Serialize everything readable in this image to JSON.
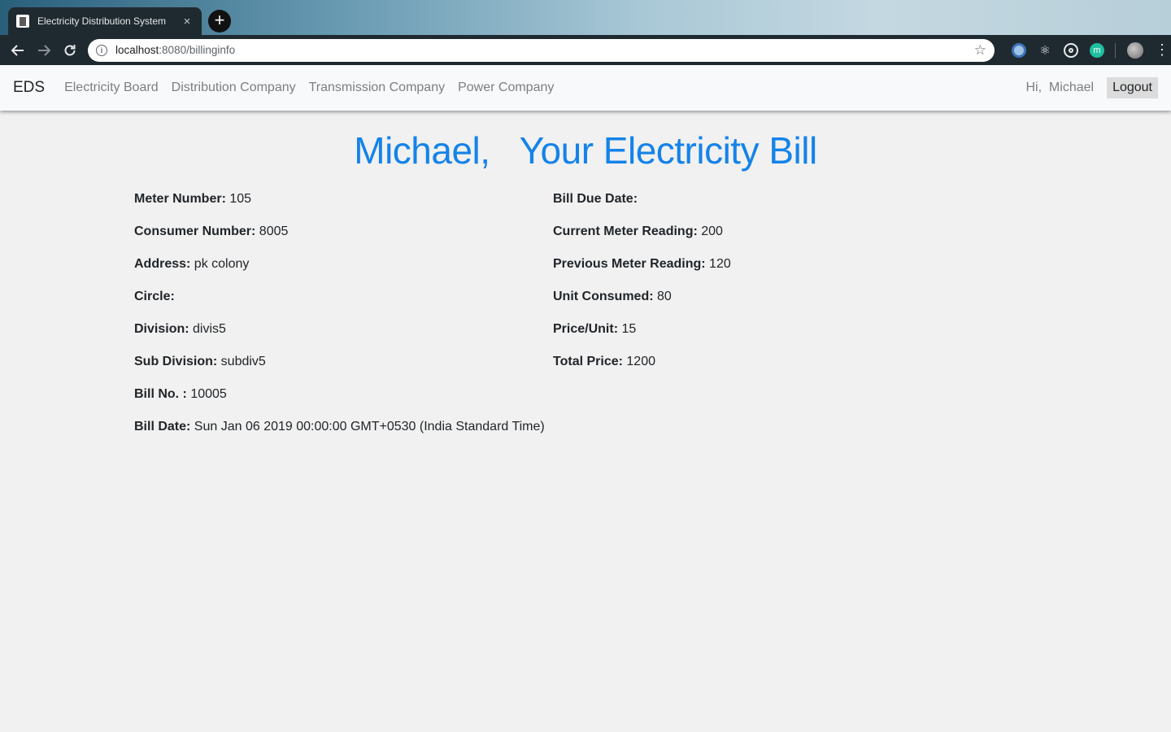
{
  "browser": {
    "tab_title": "Electricity Distribution System",
    "tab_close": "×",
    "new_tab": "+",
    "url_host": "localhost",
    "url_rest": ":8080/billinginfo"
  },
  "navbar": {
    "brand": "EDS",
    "links": [
      "Electricity Board",
      "Distribution Company",
      "Transmission Company",
      "Power Company"
    ],
    "greeting": "Hi,  Michael",
    "logout": "Logout"
  },
  "page": {
    "title": "Michael,   Your Electricity Bill"
  },
  "bill": {
    "left": [
      {
        "label": "Meter Number:",
        "value": " 105"
      },
      {
        "label": "Consumer Number:",
        "value": " 8005"
      },
      {
        "label": "Address:",
        "value": " pk colony"
      },
      {
        "label": "Circle:",
        "value": ""
      },
      {
        "label": "Division:",
        "value": " divis5"
      },
      {
        "label": "Sub Division:",
        "value": " subdiv5"
      },
      {
        "label": "Bill No. :",
        "value": " 10005"
      },
      {
        "label": "Bill Date:",
        "value": " Sun Jan 06 2019 00:00:00 GMT+0530 (India Standard Time)"
      }
    ],
    "right": [
      {
        "label": "Bill Due Date:",
        "value": ""
      },
      {
        "label": "Current Meter Reading:",
        "value": " 200"
      },
      {
        "label": "Previous Meter Reading:",
        "value": " 120"
      },
      {
        "label": "Unit Consumed:",
        "value": " 80"
      },
      {
        "label": "Price/Unit:",
        "value": " 15"
      },
      {
        "label": "Total Price:",
        "value": " 1200"
      }
    ]
  }
}
